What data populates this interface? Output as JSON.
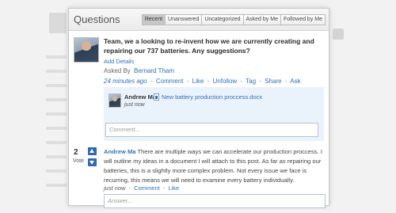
{
  "panel": {
    "title": "Questions",
    "tabs": [
      "Recent",
      "Unanswered",
      "Uncategorized",
      "Asked by Me",
      "Followed by Me"
    ],
    "active_tab": "Recent"
  },
  "question": {
    "text": "Team, we a looking to re-invent how we are currently creating and repairing our 737 batteries. Any suggestions?",
    "add_details": "Add Details",
    "asked_by_label": "Asked By",
    "asked_by_name": "Bernard Tham",
    "time": "24 minutes ago",
    "actions": [
      "Comment",
      "Like",
      "Unfollow",
      "Tag",
      "Share",
      "Ask"
    ]
  },
  "comment": {
    "author": "Andrew Ma",
    "file": "New battery production proccess.docx",
    "time": "just now",
    "input_placeholder": "Comment..."
  },
  "answer": {
    "votes": "2",
    "vote_label": "Vote",
    "author": "Andrew Ma",
    "text": "There are multiple ways we can accelerate our production proccess. I will outline my ideas in a document I will attach to this post. As far as repairing our batteries, this is a slightly more complex problem. Not every issue we face is recurring, this means we will need to examine every battery individually.",
    "time": "just now",
    "actions": [
      "Comment",
      "Like"
    ],
    "input_placeholder": "Answer..."
  },
  "icons": {
    "vote_up": "arrow-up-icon",
    "vote_down": "arrow-down-icon",
    "attachment": "word-document-icon"
  },
  "colors": {
    "link": "#2f73b8",
    "vote": "#2e6ab3",
    "comment_bg": "#eaf2fb"
  }
}
